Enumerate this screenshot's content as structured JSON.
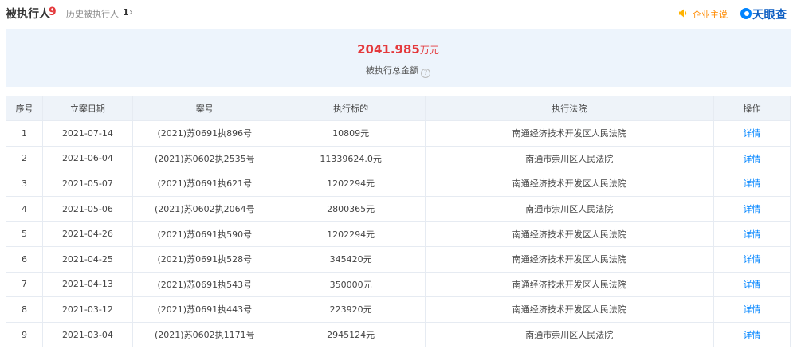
{
  "header": {
    "title": "被执行人",
    "count": "9",
    "history_label": "历史被执行人",
    "history_count": "1",
    "owner_link": "企业主说",
    "logo_text": "天眼查"
  },
  "summary": {
    "amount": "2041.985",
    "unit": "万元",
    "label": "被执行总金额",
    "help": "?"
  },
  "table": {
    "columns": [
      "序号",
      "立案日期",
      "案号",
      "执行标的",
      "执行法院",
      "操作"
    ],
    "rows": [
      {
        "no": "1",
        "date": "2021-07-14",
        "case": "(2021)苏0691执896号",
        "amount": "10809元",
        "court": "南通经济技术开发区人民法院",
        "action": "详情"
      },
      {
        "no": "2",
        "date": "2021-06-04",
        "case": "(2021)苏0602执2535号",
        "amount": "11339624.0元",
        "court": "南通市崇川区人民法院",
        "action": "详情"
      },
      {
        "no": "3",
        "date": "2021-05-07",
        "case": "(2021)苏0691执621号",
        "amount": "1202294元",
        "court": "南通经济技术开发区人民法院",
        "action": "详情"
      },
      {
        "no": "4",
        "date": "2021-05-06",
        "case": "(2021)苏0602执2064号",
        "amount": "2800365元",
        "court": "南通市崇川区人民法院",
        "action": "详情"
      },
      {
        "no": "5",
        "date": "2021-04-26",
        "case": "(2021)苏0691执590号",
        "amount": "1202294元",
        "court": "南通经济技术开发区人民法院",
        "action": "详情"
      },
      {
        "no": "6",
        "date": "2021-04-25",
        "case": "(2021)苏0691执528号",
        "amount": "345420元",
        "court": "南通经济技术开发区人民法院",
        "action": "详情"
      },
      {
        "no": "7",
        "date": "2021-04-13",
        "case": "(2021)苏0691执543号",
        "amount": "350000元",
        "court": "南通经济技术开发区人民法院",
        "action": "详情"
      },
      {
        "no": "8",
        "date": "2021-03-12",
        "case": "(2021)苏0691执443号",
        "amount": "223920元",
        "court": "南通经济技术开发区人民法院",
        "action": "详情"
      },
      {
        "no": "9",
        "date": "2021-03-04",
        "case": "(2021)苏0602执1171号",
        "amount": "2945124元",
        "court": "南通市崇川区人民法院",
        "action": "详情"
      }
    ]
  },
  "colors": {
    "accent_red": "#e4393c",
    "link_blue": "#0084ff",
    "owner_orange": "#ff8a00",
    "summary_bg": "#edf4fc"
  },
  "icons": [
    "speaker-icon",
    "tianyancha-logo-icon",
    "help-icon",
    "chevron-right-icon"
  ]
}
